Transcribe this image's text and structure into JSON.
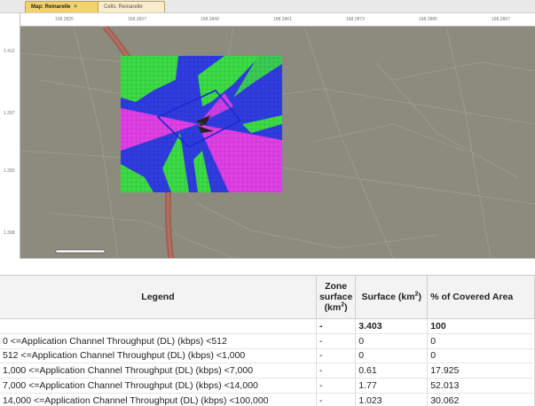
{
  "tabs": [
    {
      "label": "Map: Reinarelle",
      "close": "×"
    },
    {
      "label": "Cells: Reinarelle"
    }
  ],
  "ruler": {
    "top_ticks": [
      "168.2825",
      "168.2837",
      "168.2849",
      "168.2861",
      "168.2873",
      "168.2885",
      "168.2897"
    ],
    "left_ticks": [
      "1.412",
      "1.397",
      "1.383",
      "1.368"
    ]
  },
  "map": {
    "coverage_colors": {
      "low": "#2f3de0",
      "mid": "#e040e6",
      "high": "#3cdc46"
    },
    "sector_outline_color": "#1a2bd0"
  },
  "table": {
    "headers": {
      "legend": "Legend",
      "zone_line1": "Zone",
      "zone_line2": "surface",
      "zone_line3": "(km",
      "zone_sup": "2",
      "zone_close": ")",
      "surface": "Surface (km",
      "surface_sup": "2",
      "surface_close": ")",
      "pct": "% of Covered Area"
    },
    "rows": [
      {
        "legend": "",
        "zone": "-",
        "surface": "3.403",
        "pct": "100"
      },
      {
        "legend": "0 <=Application Channel Throughput (DL) (kbps) <512",
        "zone": "-",
        "surface": "0",
        "pct": "0"
      },
      {
        "legend": "512 <=Application Channel Throughput (DL) (kbps) <1,000",
        "zone": "-",
        "surface": "0",
        "pct": "0"
      },
      {
        "legend": "1,000 <=Application Channel Throughput (DL) (kbps) <7,000",
        "zone": "-",
        "surface": "0.61",
        "pct": "17.925"
      },
      {
        "legend": "7,000 <=Application Channel Throughput (DL) (kbps) <14,000",
        "zone": "-",
        "surface": "1.77",
        "pct": "52.013"
      },
      {
        "legend": "14,000 <=Application Channel Throughput (DL) (kbps) <100,000",
        "zone": "-",
        "surface": "1.023",
        "pct": "30.062"
      }
    ]
  }
}
